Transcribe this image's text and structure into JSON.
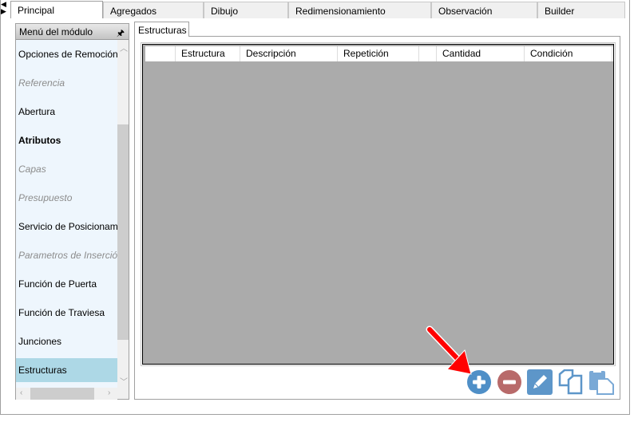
{
  "tabs": [
    {
      "label": "Principal"
    },
    {
      "label": "Agregados"
    },
    {
      "label": "Dibujo"
    },
    {
      "label": "Redimensionamiento"
    },
    {
      "label": "Observación"
    },
    {
      "label": "Builder"
    }
  ],
  "sidebar": {
    "title": "Menú del módulo",
    "items": [
      {
        "label": "Opciones de Remoción",
        "state": "normal"
      },
      {
        "label": "Referencia",
        "state": "disabled"
      },
      {
        "label": "Abertura",
        "state": "normal"
      },
      {
        "label": "Atributos",
        "state": "bold"
      },
      {
        "label": "Capas",
        "state": "disabled"
      },
      {
        "label": "Presupuesto",
        "state": "disabled"
      },
      {
        "label": "Servicio de Posicionamiento",
        "state": "normal"
      },
      {
        "label": "Parametros de Inserción",
        "state": "disabled"
      },
      {
        "label": "Función de Puerta",
        "state": "normal"
      },
      {
        "label": "Función de Traviesa",
        "state": "normal"
      },
      {
        "label": "Junciones",
        "state": "normal"
      },
      {
        "label": "Estructuras",
        "state": "selected"
      }
    ]
  },
  "subtab": {
    "label": "Estructuras"
  },
  "grid": {
    "columns": [
      "",
      "Estructura",
      "Descripción",
      "Repetición",
      "",
      "Cantidad",
      "Condición"
    ]
  },
  "toolbar": {
    "buttons": [
      {
        "name": "add",
        "color": "#4f8fc7"
      },
      {
        "name": "remove",
        "color": "#b86a6a"
      },
      {
        "name": "edit",
        "color": "#5d96c9"
      },
      {
        "name": "copy",
        "color": "#5d96c9"
      },
      {
        "name": "paste",
        "color": "#7aa9d6"
      }
    ]
  }
}
